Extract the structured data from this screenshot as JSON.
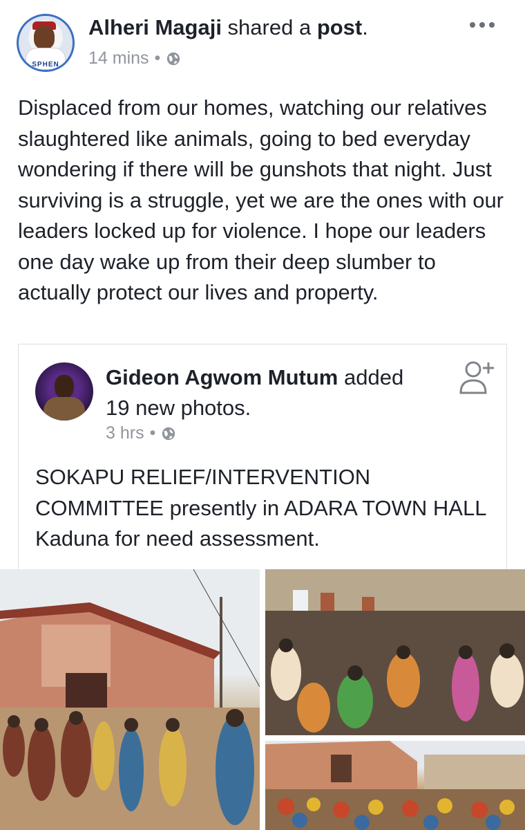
{
  "post": {
    "author": "Alheri Magaji",
    "action_text": " shared a ",
    "object_text": "post",
    "object_suffix": ".",
    "timestamp": "14 mins",
    "separator": "•",
    "privacy_icon": "globe-icon",
    "avatar_text": "SPHEN",
    "body": "Displaced from our homes, watching our relatives slaughtered like animals, going to bed everyday wondering if there will be gunshots that night. Just surviving is a struggle, yet we are the ones with our leaders locked up for violence. I hope our leaders one day wake up from their deep slumber to actually protect our lives and property."
  },
  "shared": {
    "author": "Gideon Agwom Mutum",
    "action_text": " added 19 new photos.",
    "timestamp": "3 hrs",
    "separator": "•",
    "privacy_icon": "globe-icon",
    "body": "SOKAPU  RELIEF/INTERVENTION COMMITTEE presently in ADARA TOWN HALL Kaduna for need assessment."
  },
  "colors": {
    "meta_gray": "#90949c",
    "text": "#1d2129",
    "avatar_ring": "#3b6fc2",
    "card_border": "#dddfe2"
  }
}
